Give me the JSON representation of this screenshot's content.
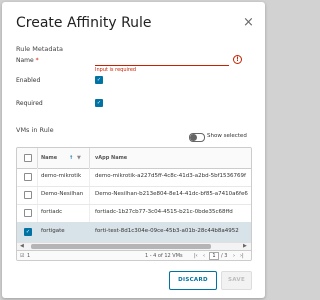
{
  "dialog": {
    "title": "Create Affinity Rule",
    "close_glyph": "×"
  },
  "metadata": {
    "section_title": "Rule Metadata",
    "name_label": "Name",
    "name_required_marker": "*",
    "name_value": "",
    "name_error": "Input is required",
    "error_icon_glyph": "!",
    "enabled_label": "Enabled",
    "enabled_checked": true,
    "required_label": "Required",
    "required_checked": true
  },
  "vms": {
    "section_title": "VMs in Rule",
    "show_selected_label": "Show selected",
    "show_selected_on": false,
    "columns": {
      "name": "Name",
      "sort_glyph": "↑",
      "filter_glyph": "▼",
      "vapp": "vApp Name"
    },
    "rows": [
      {
        "name": "demo-mikrotik",
        "vapp": "demo-mikrotik-a227d5ff-4c8c-41d3-a2bd-5bf1536769f",
        "checked": false
      },
      {
        "name": "Demo-Nesilhan",
        "vapp": "Demo-Nesilhan-b213e804-8e14-41dc-bf85-a7410a6fe6",
        "checked": false
      },
      {
        "name": "fortiadc",
        "vapp": "fortiadc-1b27cb77-3c04-4515-b21c-0bde35c68ffd",
        "checked": false
      },
      {
        "name": "fortigate",
        "vapp": "forti-test-8d1c304e-09ce-45b3-a01b-28c44b8a4952",
        "checked": true
      }
    ],
    "selected_count": "1",
    "range_text": "1 - 4 of 12 VMs",
    "pagination": {
      "first": "|‹",
      "prev": "‹",
      "page": "1",
      "of_text": "/ 3",
      "next": "›",
      "last": "›|"
    }
  },
  "buttons": {
    "discard": "DISCARD",
    "save": "SAVE"
  },
  "colors": {
    "accent": "#0072a3",
    "error": "#c92100",
    "selected_row": "#d8e3e9"
  }
}
